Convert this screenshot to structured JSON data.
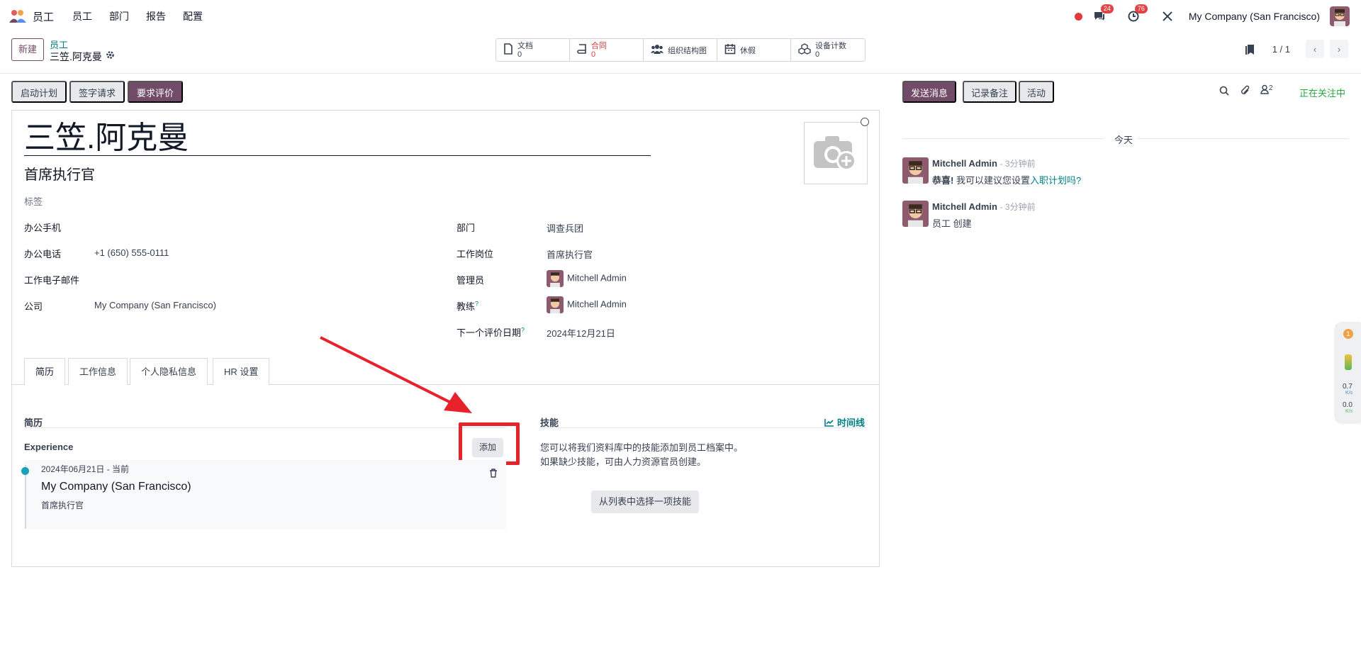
{
  "navbar": {
    "app_name": "员工",
    "menu": [
      "员工",
      "部门",
      "报告",
      "配置"
    ],
    "messages_count": "24",
    "activities_count": "76",
    "company": "My Company (San Francisco)"
  },
  "control_panel": {
    "new_button": "新建",
    "breadcrumb_parent": "员工",
    "breadcrumb_current": "三笠.阿克曼",
    "pager": "1 / 1",
    "smart_buttons": [
      {
        "label": "文档",
        "value": "0",
        "icon": "file-icon"
      },
      {
        "label": "合同",
        "value": "0",
        "icon": "book-icon"
      },
      {
        "label": "组织结构图",
        "value": "",
        "icon": "users-icon"
      },
      {
        "label": "休假",
        "value": "",
        "icon": "calendar-icon"
      },
      {
        "label": "设备计数",
        "value": "0",
        "icon": "cubes-icon"
      }
    ]
  },
  "status_bar": {
    "onboarding": "启动计划",
    "signature": "签字请求",
    "appraisal": "要求评价"
  },
  "form": {
    "name": "三笠.阿克曼",
    "job_title": "首席执行官",
    "tags_placeholder": "标签",
    "left_fields": [
      {
        "label": "办公手机",
        "value": ""
      },
      {
        "label": "办公电话",
        "value": "+1 (650) 555-0111"
      },
      {
        "label": "工作电子邮件",
        "value": ""
      },
      {
        "label": "公司",
        "value": "My Company (San Francisco)"
      }
    ],
    "right_fields": {
      "department_label": "部门",
      "department": "调查兵团",
      "position_label": "工作岗位",
      "position": "首席执行官",
      "manager_label": "管理员",
      "manager": "Mitchell Admin",
      "coach_label": "教练",
      "coach": "Mitchell Admin",
      "next_appraisal_label": "下一个评价日期",
      "next_appraisal": "2024年12月21日",
      "help_mark": "?"
    },
    "tabs": [
      "简历",
      "工作信息",
      "个人隐私信息",
      "HR 设置"
    ],
    "resume": {
      "title": "简历",
      "section": "Experience",
      "add_button": "添加",
      "line": {
        "dates": "2024年06月21日 - 当前",
        "company": "My Company (San Francisco)",
        "description": "首席执行官"
      }
    },
    "skills": {
      "title": "技能",
      "timeline_link": "时间线",
      "hint_line1": "您可以将我们资料库中的技能添加到员工档案中。",
      "hint_line2": "如果缺少技能，可由人力资源官员创建。",
      "pick_button": "从列表中选择一项技能"
    }
  },
  "chatter": {
    "send_message": "发送消息",
    "log_note": "记录备注",
    "activities": "活动",
    "followers_count": "2",
    "following": "正在关注中",
    "today": "今天",
    "messages": [
      {
        "author": "Mitchell Admin",
        "time": "- 3分钟前",
        "bold": "恭喜!",
        "text": " 我可以建议您设置",
        "link": "入职计划吗?"
      },
      {
        "author": "Mitchell Admin",
        "time": "- 3分钟前",
        "bold": "",
        "text": "员工 创建",
        "link": ""
      }
    ]
  },
  "side_widget": {
    "badge": "1",
    "up_speed": "0.7",
    "down_speed": "0.0",
    "unit": "K/s"
  },
  "colors": {
    "brand": "#714b67",
    "link": "#017e84",
    "following": "#28a745",
    "annotation": "#e8222b"
  }
}
